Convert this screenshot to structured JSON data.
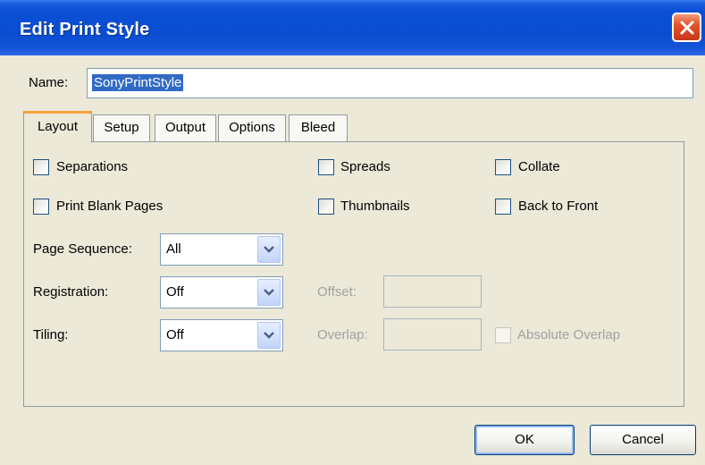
{
  "window": {
    "title": "Edit Print Style"
  },
  "name_field": {
    "label": "Name:",
    "value": "SonyPrintStyle"
  },
  "tabs": [
    {
      "label": "Layout",
      "active": true
    },
    {
      "label": "Setup",
      "active": false
    },
    {
      "label": "Output",
      "active": false
    },
    {
      "label": "Options",
      "active": false
    },
    {
      "label": "Bleed",
      "active": false
    }
  ],
  "layout": {
    "checkboxes": {
      "separations": {
        "label": "Separations",
        "checked": false
      },
      "spreads": {
        "label": "Spreads",
        "checked": false
      },
      "collate": {
        "label": "Collate",
        "checked": false
      },
      "print_blank_pages": {
        "label": "Print Blank Pages",
        "checked": false
      },
      "thumbnails": {
        "label": "Thumbnails",
        "checked": false
      },
      "back_to_front": {
        "label": "Back to Front",
        "checked": false
      },
      "absolute_overlap": {
        "label": "Absolute Overlap",
        "checked": false,
        "enabled": false
      }
    },
    "page_sequence": {
      "label": "Page Sequence:",
      "value": "All"
    },
    "registration": {
      "label": "Registration:",
      "value": "Off"
    },
    "tiling": {
      "label": "Tiling:",
      "value": "Off"
    },
    "offset": {
      "label": "Offset:",
      "value": "",
      "enabled": false
    },
    "overlap": {
      "label": "Overlap:",
      "value": "",
      "enabled": false
    }
  },
  "buttons": {
    "ok": "OK",
    "cancel": "Cancel"
  },
  "colors": {
    "titlebar": "#0a4dd0",
    "active_tab_accent": "#f7a33a",
    "selection": "#316ac5",
    "close_button": "#e2542a"
  }
}
